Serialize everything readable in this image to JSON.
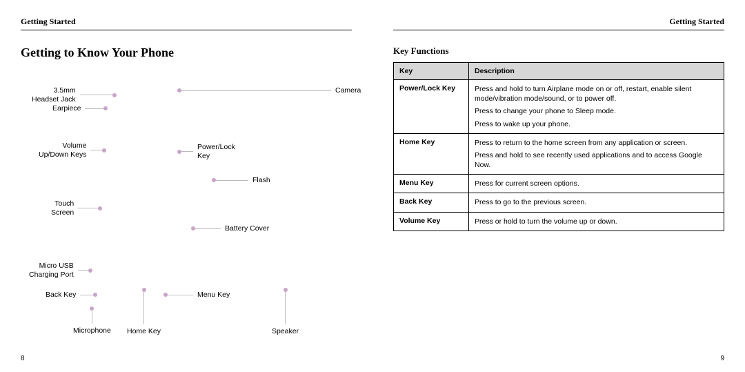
{
  "left": {
    "header": "Getting Started",
    "title": "Getting to Know Your Phone",
    "page_num": "8",
    "callouts": {
      "headset_jack": "3.5mm\nHeadset Jack",
      "earpiece": "Earpiece",
      "volume_keys": "Volume\nUp/Down Keys",
      "touch_screen": "Touch\nScreen",
      "micro_usb": "Micro USB\nCharging Port",
      "back_key": "Back Key",
      "microphone": "Microphone",
      "home_key": "Home Key",
      "camera": "Camera",
      "power_lock": "Power/Lock\nKey",
      "flash": "Flash",
      "battery_cover": "Battery Cover",
      "menu_key": "Menu Key",
      "speaker": "Speaker"
    }
  },
  "right": {
    "header": "Getting Started",
    "title": "Key Functions",
    "page_num": "9",
    "table": {
      "head_key": "Key",
      "head_desc": "Description",
      "rows": [
        {
          "key": "Power/Lock Key",
          "desc": [
            "Press and hold to turn Airplane mode on or off, restart, enable silent mode/vibration mode/sound, or to power off.",
            "Press to change your phone to Sleep mode.",
            "Press to wake up your phone."
          ]
        },
        {
          "key": "Home Key",
          "desc": [
            "Press to return to the home screen from any application or screen.",
            "Press and hold to see recently used applications and to access Google Now."
          ]
        },
        {
          "key": "Menu Key",
          "desc": [
            "Press for current screen options."
          ]
        },
        {
          "key": "Back Key",
          "desc": [
            "Press to go to the previous screen."
          ]
        },
        {
          "key": "Volume Key",
          "desc": [
            "Press or hold to turn the volume up or down."
          ]
        }
      ]
    }
  }
}
